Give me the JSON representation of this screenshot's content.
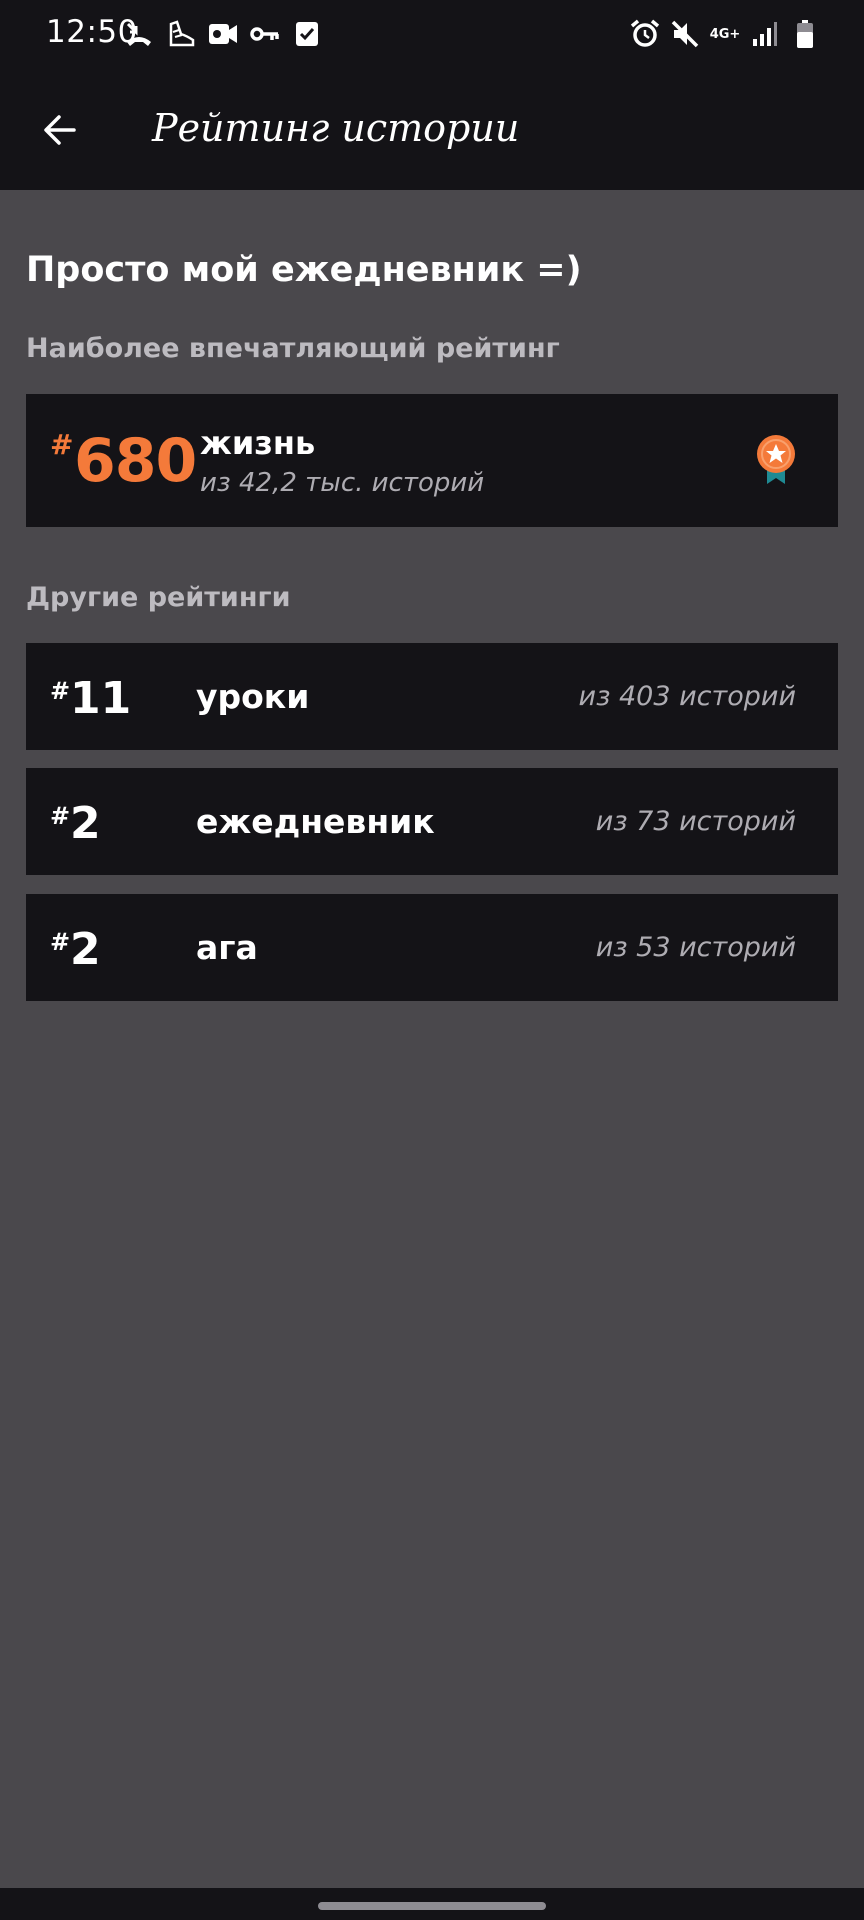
{
  "status_bar": {
    "time": "12:50",
    "left_icons": [
      "missed-call-icon",
      "shoe-icon",
      "video-camera-icon",
      "key-icon",
      "checkbox-icon"
    ],
    "right_icons": [
      "alarm-icon",
      "mute-icon",
      "network-icon",
      "signal-icon",
      "battery-icon"
    ],
    "network": "4G+"
  },
  "app_bar": {
    "back_icon": "arrow-left-icon",
    "title": "Рейтинг истории"
  },
  "story": {
    "title": "Просто мой ежедневник =)"
  },
  "top_rating": {
    "section_label": "Наиболее впечатляющий рейтинг",
    "hash": "#",
    "rank": "680",
    "tag": "жизнь",
    "subtitle": "из 42,2 тыс. историй",
    "badge_icon": "medal-icon",
    "accent_color": "#f47a3a"
  },
  "other_ratings": {
    "section_label": "Другие рейтинги",
    "items": [
      {
        "hash": "#",
        "rank": "11",
        "tag": "уроки",
        "subtitle": "из 403 историй"
      },
      {
        "hash": "#",
        "rank": "2",
        "tag": "ежедневник",
        "subtitle": "из 73 историй"
      },
      {
        "hash": "#",
        "rank": "2",
        "tag": "ага",
        "subtitle": "из 53 историй"
      }
    ]
  }
}
